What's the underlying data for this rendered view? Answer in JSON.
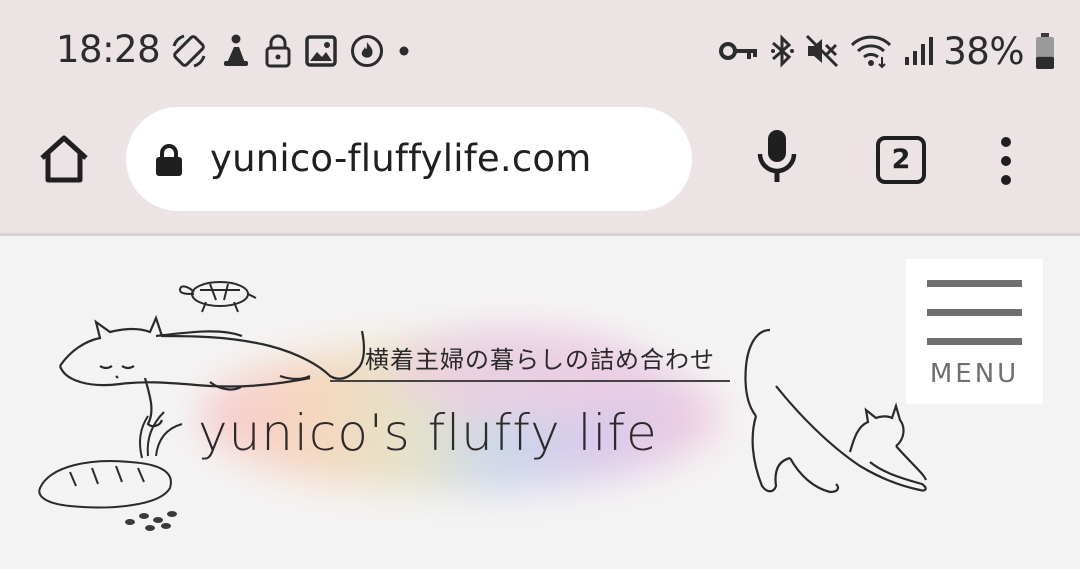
{
  "status_bar": {
    "time": "18:28",
    "battery_percent": "38%",
    "battery_level": 0.38,
    "left_icons": [
      "autorotate-icon",
      "accessibility-icon",
      "lock-icon",
      "image-icon",
      "fire-icon",
      "dot-icon"
    ],
    "right_icons": [
      "vpn-key-icon",
      "bluetooth-icon",
      "mute-icon",
      "wifi-icon",
      "signal-icon",
      "battery-icon"
    ]
  },
  "browser": {
    "url": "yunico-fluffylife.com",
    "tab_count": "2"
  },
  "site": {
    "tagline": "横着主婦の暮らしの詰め合わせ",
    "title": "yunico's fluffy life",
    "menu_label": "MENU"
  },
  "colors": {
    "chrome_bg": "#ebe3e4",
    "page_bg": "#f4f3f3",
    "menu_gray": "#6f6f6f"
  }
}
